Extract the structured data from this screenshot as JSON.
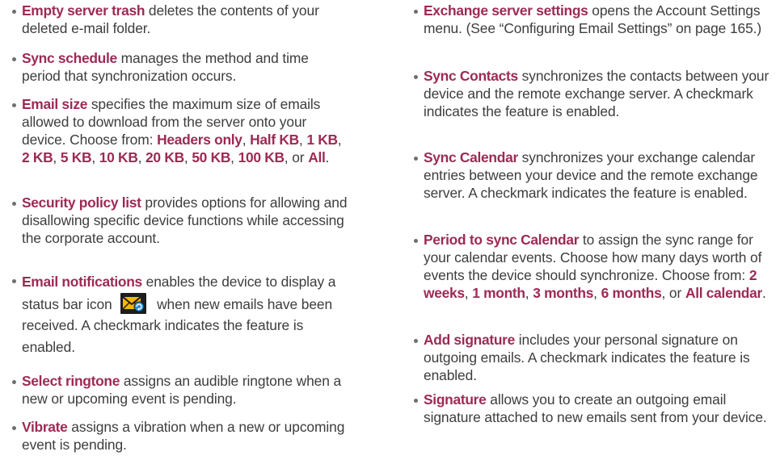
{
  "left_column": [
    {
      "term": "Empty server trash",
      "text": " deletes the contents of your deleted e-mail folder."
    },
    {
      "term": "Sync schedule",
      "text": " manages the method and time period that synchronization occurs."
    },
    {
      "term": "Email size",
      "text_before": " specifies the maximum size of emails allowed to download from the server onto your device. Choose from: ",
      "options": [
        "Headers only",
        "Half KB",
        "1 KB",
        "2 KB",
        "5 KB",
        "10 KB",
        "20 KB",
        "50 KB",
        "100 KB",
        "All"
      ],
      "separators": [
        ", ",
        ", ",
        ", ",
        ", ",
        ", ",
        ", ",
        ", ",
        ", ",
        ", or "
      ],
      "text_after": "."
    },
    {
      "term": "Security policy list",
      "text": " provides options for allowing and disallowing specific device functions while accessing the corporate account."
    },
    {
      "term": "Email notifications",
      "text_before_icon": " enables the device to display a status bar icon ",
      "icon": "new-email-notification-icon",
      "text_after_icon": " when new emails have been received. A checkmark indicates the feature is enabled."
    },
    {
      "term": "Select ringtone",
      "text": " assigns an audible ringtone when a new or upcoming event is pending."
    },
    {
      "term": "Vibrate",
      "text": " assigns a vibration when a new or upcoming event is pending."
    }
  ],
  "right_column": [
    {
      "term": "Exchange server settings",
      "text": " opens the Account Settings menu. (See “Configuring Email Settings” on page 165.)"
    },
    {
      "term": "Sync Contacts",
      "text": " synchronizes the contacts between your device and the remote exchange server. A checkmark indicates the feature is enabled."
    },
    {
      "term": "Sync Calendar",
      "text": " synchronizes your exchange calendar entries between your device and the remote exchange server. A checkmark indicates the feature is enabled."
    },
    {
      "term": "Period to sync Calendar",
      "text_before": " to assign the sync range for your calendar events. Choose how many days worth of events the device should synchronize. Choose from: ",
      "options": [
        "2 weeks",
        "1 month",
        "3 months",
        "6 months",
        "All calendar"
      ],
      "separators": [
        ", ",
        ", ",
        ", ",
        ", or "
      ],
      "text_after": "."
    },
    {
      "term": "Add signature",
      "text": " includes your personal signature on outgoing emails. A checkmark indicates the feature is enabled."
    },
    {
      "term": "Signature",
      "text": " allows you to create an outgoing email signature attached to new emails sent from your device."
    }
  ],
  "colors": {
    "term": "#9c2a55",
    "body_text": "#3d3d3d",
    "bullet": "#6e6e6e",
    "icon_background": "#1d1d1d",
    "icon_envelope": "#f5b800"
  }
}
